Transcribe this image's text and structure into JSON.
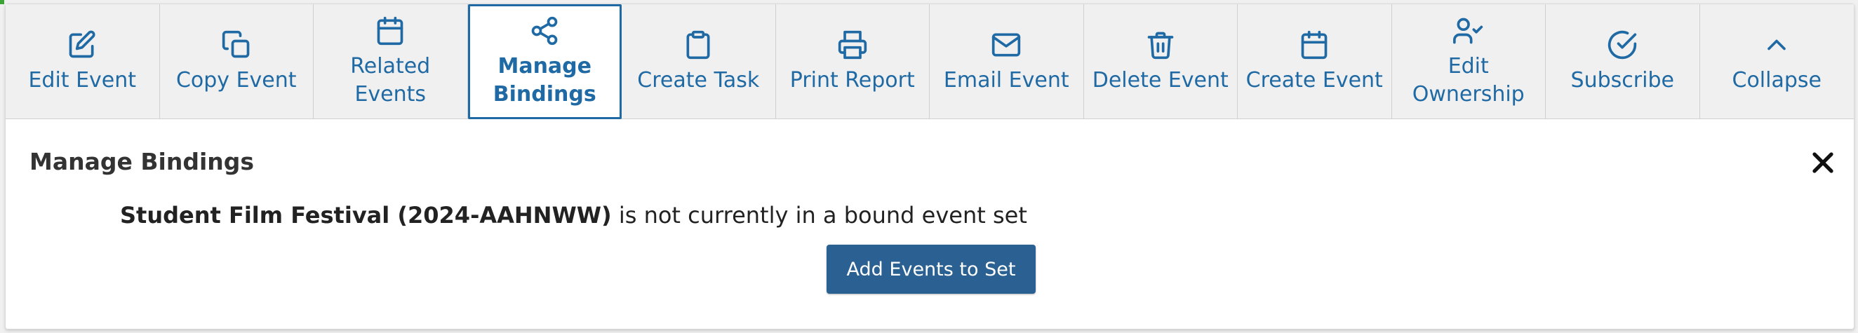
{
  "toolbar": {
    "items": [
      {
        "label": "Edit Event",
        "icon": "edit-icon"
      },
      {
        "label": "Copy Event",
        "icon": "copy-icon"
      },
      {
        "label": "Related\nEvents",
        "icon": "calendar-icon"
      },
      {
        "label": "Manage\nBindings",
        "icon": "share-icon",
        "active": true
      },
      {
        "label": "Create Task",
        "icon": "clipboard-icon"
      },
      {
        "label": "Print Report",
        "icon": "printer-icon"
      },
      {
        "label": "Email Event",
        "icon": "mail-icon"
      },
      {
        "label": "Delete Event",
        "icon": "trash-icon"
      },
      {
        "label": "Create Event",
        "icon": "calendar-icon"
      },
      {
        "label": "Edit\nOwnership",
        "icon": "user-check-icon"
      },
      {
        "label": "Subscribe",
        "icon": "check-circle-icon"
      },
      {
        "label": "Collapse",
        "icon": "chevron-up-icon"
      }
    ]
  },
  "panel": {
    "title": "Manage Bindings",
    "event_name": "Student Film Festival (2024-AAHNWW)",
    "message_suffix": " is not currently in a bound event set",
    "add_button_label": "Add Events to Set"
  },
  "colors": {
    "accent": "#1f6aa4",
    "button": "#2a6192",
    "toolbar_bg": "#f0f0f0"
  }
}
